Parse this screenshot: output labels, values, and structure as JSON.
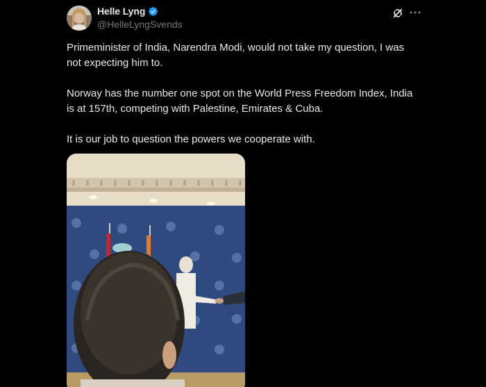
{
  "author": {
    "display_name": "Helle Lyng",
    "handle": "@HelleLyngSvends",
    "verified": true
  },
  "toolbar": {
    "grok_icon": "grok-slash-icon",
    "more_icon": "more-dots-icon"
  },
  "tweet": {
    "paragraphs": [
      "Primeminister of India, Narendra Modi, would not take my question, I was not expecting him to.",
      "Norway has the number one spot on the World Press Freedom Index, India is at 157th, competing with Palestine, Emirates & Cuba.",
      "It is our job to question the powers we cooperate with."
    ]
  },
  "colors": {
    "background": "#000000",
    "text": "#e7e9ea",
    "secondary": "#71767b",
    "verified": "#1d9bf0"
  }
}
